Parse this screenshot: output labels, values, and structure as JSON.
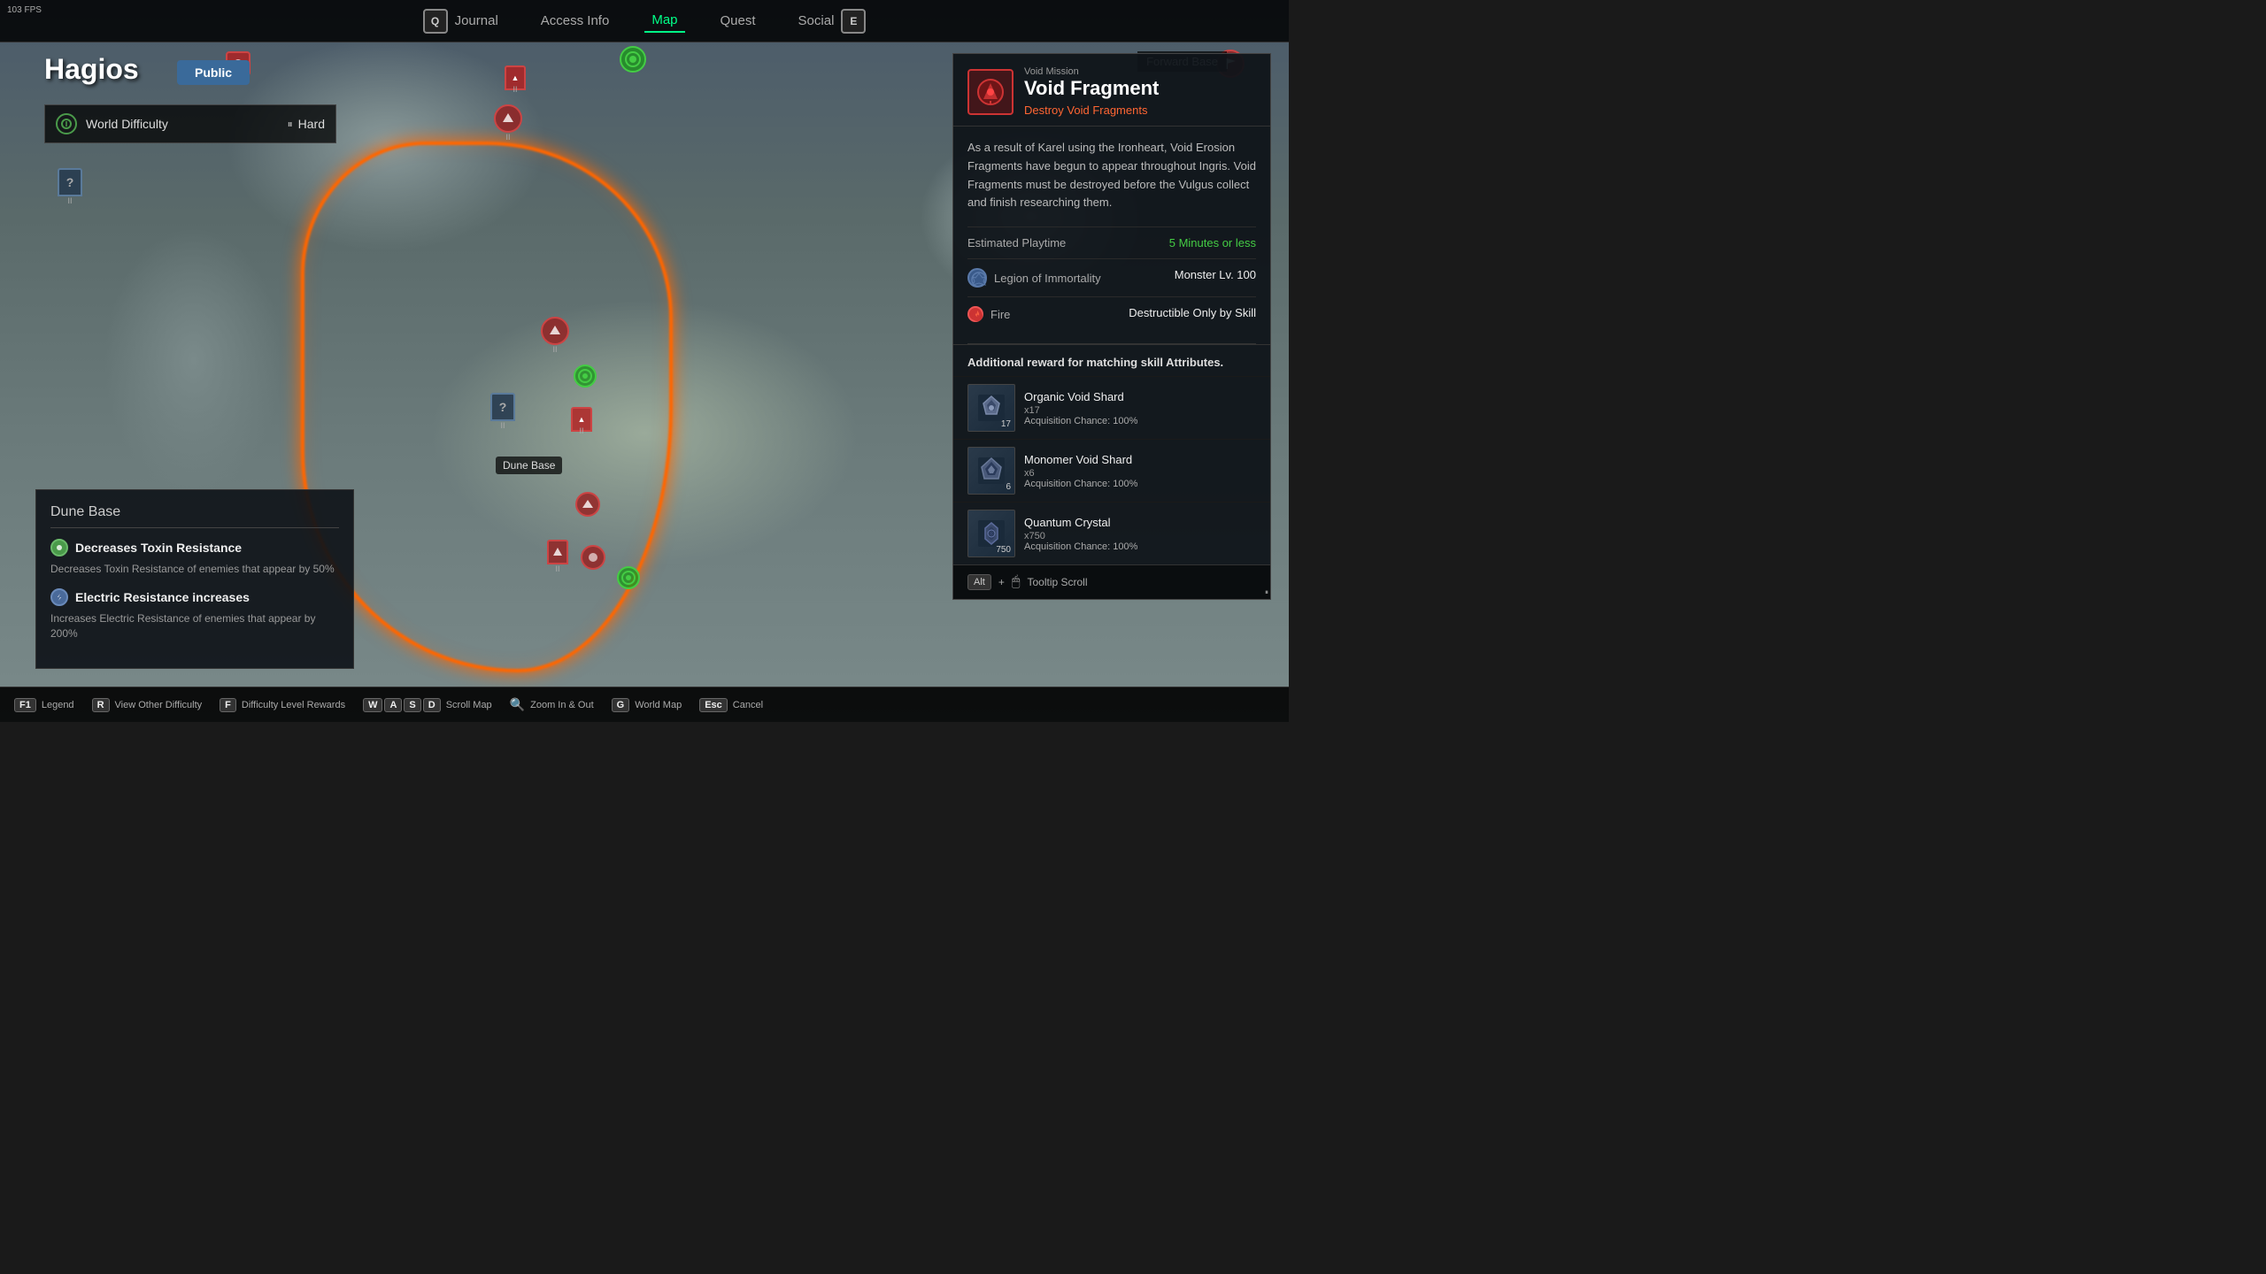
{
  "fps": "103 FPS",
  "nav": {
    "key_left": "Q",
    "key_right": "E",
    "items": [
      {
        "label": "Journal",
        "active": false
      },
      {
        "label": "Access Info",
        "active": false
      },
      {
        "label": "Map",
        "active": true
      },
      {
        "label": "Quest",
        "active": false
      },
      {
        "label": "Social",
        "active": false
      }
    ]
  },
  "map": {
    "region": "Hagios",
    "visibility": "Public",
    "forward_base": "Forward Base",
    "dune_base_label": "Dune Base"
  },
  "difficulty": {
    "label": "World Difficulty",
    "value": "Hard"
  },
  "dune_base": {
    "title": "Dune Base",
    "effects": [
      {
        "type": "green",
        "name": "Decreases Toxin Resistance",
        "desc": "Decreases Toxin Resistance of enemies that appear by 50%"
      },
      {
        "type": "blue",
        "name": "Electric Resistance increases",
        "desc": "Increases Electric Resistance of enemies that appear by 200%"
      }
    ]
  },
  "mission": {
    "type": "Void Mission",
    "name": "Void Fragment",
    "subtitle": "Destroy Void Fragments",
    "description": "As a result of Karel using the Ironheart, Void Erosion Fragments have begun to appear throughout Ingris. Void Fragments must be destroyed before the Vulgus collect and finish researching them.",
    "playtime_label": "Estimated Playtime",
    "playtime_value": "5 Minutes or less",
    "legion_label": "Legion of Immortality",
    "legion_stat": "Monster Lv. 100",
    "element_label": "Fire",
    "element_stat": "Destructible Only by Skill",
    "rewards_header": "Additional reward for matching skill Attributes.",
    "rewards": [
      {
        "name": "Organic Void Shard",
        "qty": "x17",
        "chance": "Acquisition Chance: 100%",
        "count": "17"
      },
      {
        "name": "Monomer Void Shard",
        "qty": "x6",
        "chance": "Acquisition Chance: 100%",
        "count": "6"
      },
      {
        "name": "Quantum Crystal",
        "qty": "x750",
        "chance": "Acquisition Chance: 100%",
        "count": "750"
      }
    ],
    "tooltip_scroll": "Tooltip Scroll"
  },
  "bottom_bar": {
    "hints": [
      {
        "key": "F1",
        "label": "Legend"
      },
      {
        "key": "R",
        "label": "View Other Difficulty"
      },
      {
        "key": "F",
        "label": "Difficulty Level Rewards"
      },
      {
        "keys": [
          "W",
          "A",
          "S",
          "D"
        ],
        "label": "Scroll Map"
      },
      {
        "key": "🔍",
        "label": "Zoom In & Out"
      },
      {
        "key": "G",
        "label": "World Map"
      },
      {
        "key": "Esc",
        "label": "Cancel"
      }
    ]
  },
  "colors": {
    "accent_green": "#00ff88",
    "accent_orange": "#ff6633",
    "accent_red": "#cc3333",
    "void_border": "#ff6600"
  }
}
